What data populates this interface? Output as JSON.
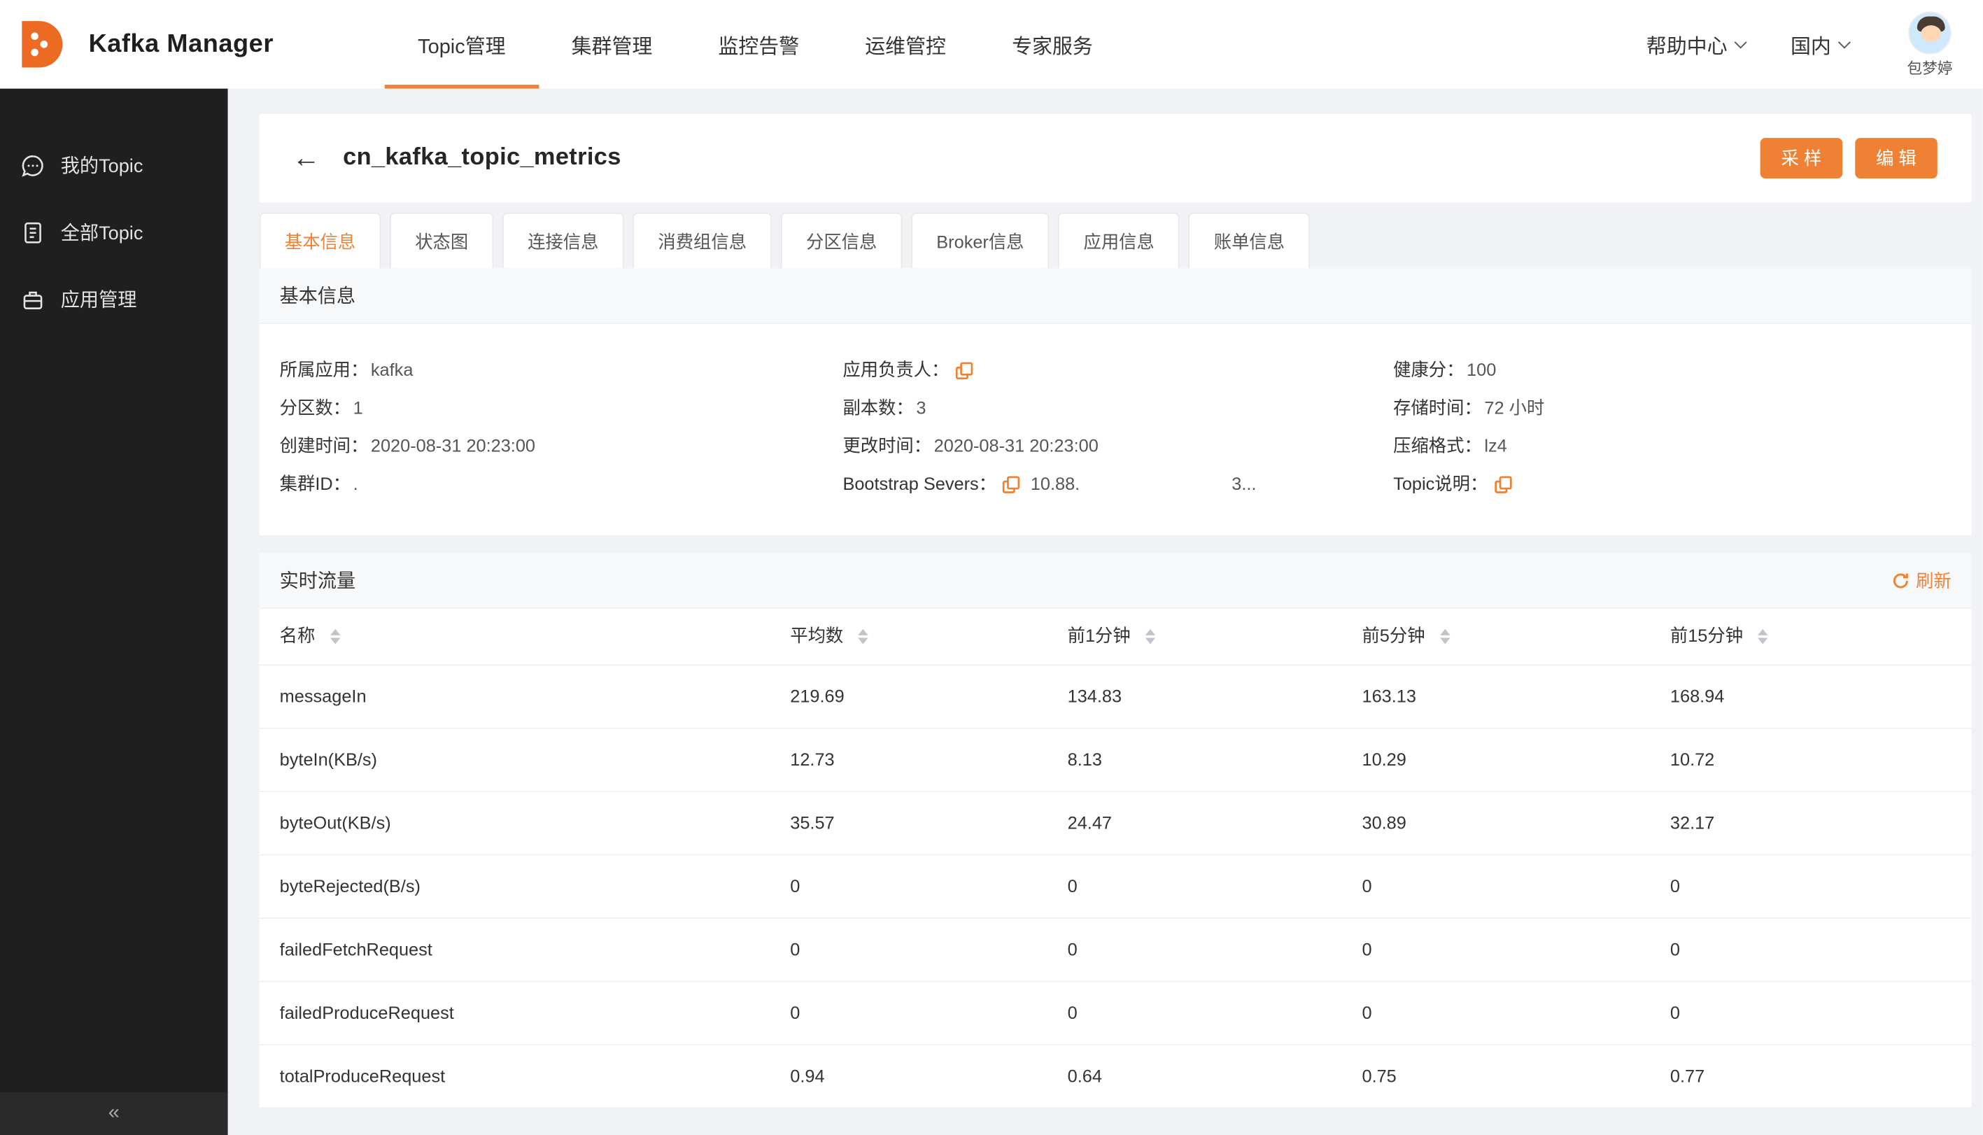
{
  "colors": {
    "accent": "#EE8133",
    "logo": "#ED6A22",
    "sidebar_bg": "#1F1F1F"
  },
  "header": {
    "brand": "Kafka Manager",
    "nav": [
      {
        "label": "Topic管理",
        "active": true
      },
      {
        "label": "集群管理",
        "active": false
      },
      {
        "label": "监控告警",
        "active": false
      },
      {
        "label": "运维管控",
        "active": false
      },
      {
        "label": "专家服务",
        "active": false
      }
    ],
    "help": "帮助中心",
    "region": "国内",
    "user_name": "包梦婷"
  },
  "sidebar": {
    "items": [
      {
        "label": "我的Topic"
      },
      {
        "label": "全部Topic"
      },
      {
        "label": "应用管理"
      }
    ],
    "collapse": "«"
  },
  "page": {
    "back": "←",
    "title": "cn_kafka_topic_metrics",
    "actions": [
      {
        "label": "采 样"
      },
      {
        "label": "编 辑"
      }
    ]
  },
  "tabs": [
    "基本信息",
    "状态图",
    "连接信息",
    "消费组信息",
    "分区信息",
    "Broker信息",
    "应用信息",
    "账单信息"
  ],
  "basic_info": {
    "section_title": "基本信息",
    "fields": [
      {
        "label": "所属应用：",
        "value": "kafka"
      },
      {
        "label": "应用负责人：",
        "value": ""
      },
      {
        "label": "健康分：",
        "value": "100"
      },
      {
        "label": "分区数：",
        "value": "1"
      },
      {
        "label": "副本数：",
        "value": "3"
      },
      {
        "label": "存储时间：",
        "value": "72 小时"
      },
      {
        "label": "创建时间：",
        "value": "2020-08-31 20:23:00"
      },
      {
        "label": "更改时间：",
        "value": "2020-08-31 20:23:00"
      },
      {
        "label": "压缩格式：",
        "value": "lz4"
      },
      {
        "label": "集群ID：",
        "value": "."
      },
      {
        "label": "Bootstrap Severs：",
        "value": "10.88.",
        "value2": "3..."
      },
      {
        "label": "Topic说明：",
        "value": ""
      }
    ]
  },
  "realtime": {
    "section_title": "实时流量",
    "refresh": "刷新",
    "table": {
      "columns": [
        "名称",
        "平均数",
        "前1分钟",
        "前5分钟",
        "前15分钟"
      ],
      "rows": [
        [
          "messageIn",
          "219.69",
          "134.83",
          "163.13",
          "168.94"
        ],
        [
          "byteIn(KB/s)",
          "12.73",
          "8.13",
          "10.29",
          "10.72"
        ],
        [
          "byteOut(KB/s)",
          "35.57",
          "24.47",
          "30.89",
          "32.17"
        ],
        [
          "byteRejected(B/s)",
          "0",
          "0",
          "0",
          "0"
        ],
        [
          "failedFetchRequest",
          "0",
          "0",
          "0",
          "0"
        ],
        [
          "failedProduceRequest",
          "0",
          "0",
          "0",
          "0"
        ],
        [
          "totalProduceRequest",
          "0.94",
          "0.64",
          "0.75",
          "0.77"
        ]
      ]
    }
  }
}
